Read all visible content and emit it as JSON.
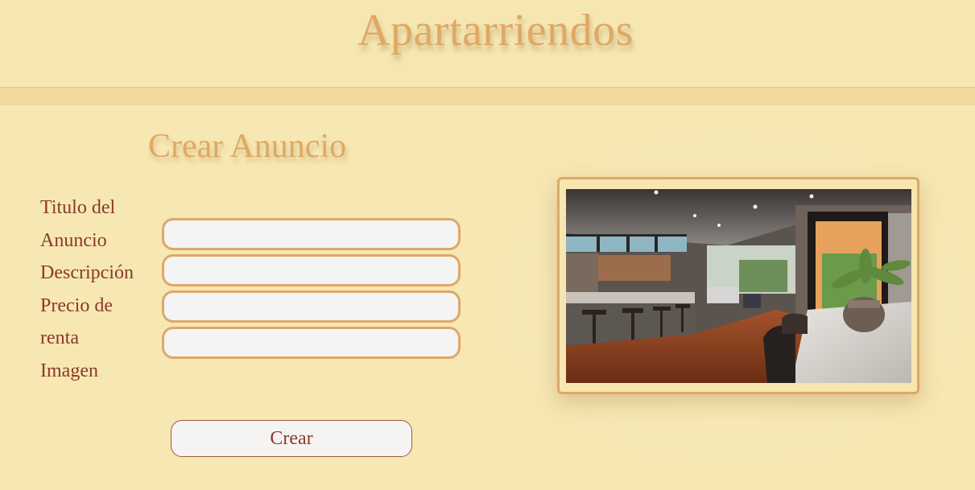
{
  "header": {
    "title": "Apartarriendos"
  },
  "form": {
    "title": "Crear Anuncio",
    "labels": {
      "titulo_line1": "Titulo del",
      "titulo_line2": "Anuncio",
      "descripcion": "Descripción",
      "precio_line1": "Precio de",
      "precio_line2": "renta",
      "imagen": "Imagen"
    },
    "fields": {
      "titulo_value": "",
      "descripcion_value": "",
      "precio_value": "",
      "imagen_value": ""
    },
    "submit_label": "Crear"
  },
  "preview": {
    "icon": "apartment-interior-photo"
  },
  "colors": {
    "background": "#f6e7b3",
    "accent": "#dfa963",
    "label_text": "#8a3a2a",
    "field_border": "#dda868"
  }
}
